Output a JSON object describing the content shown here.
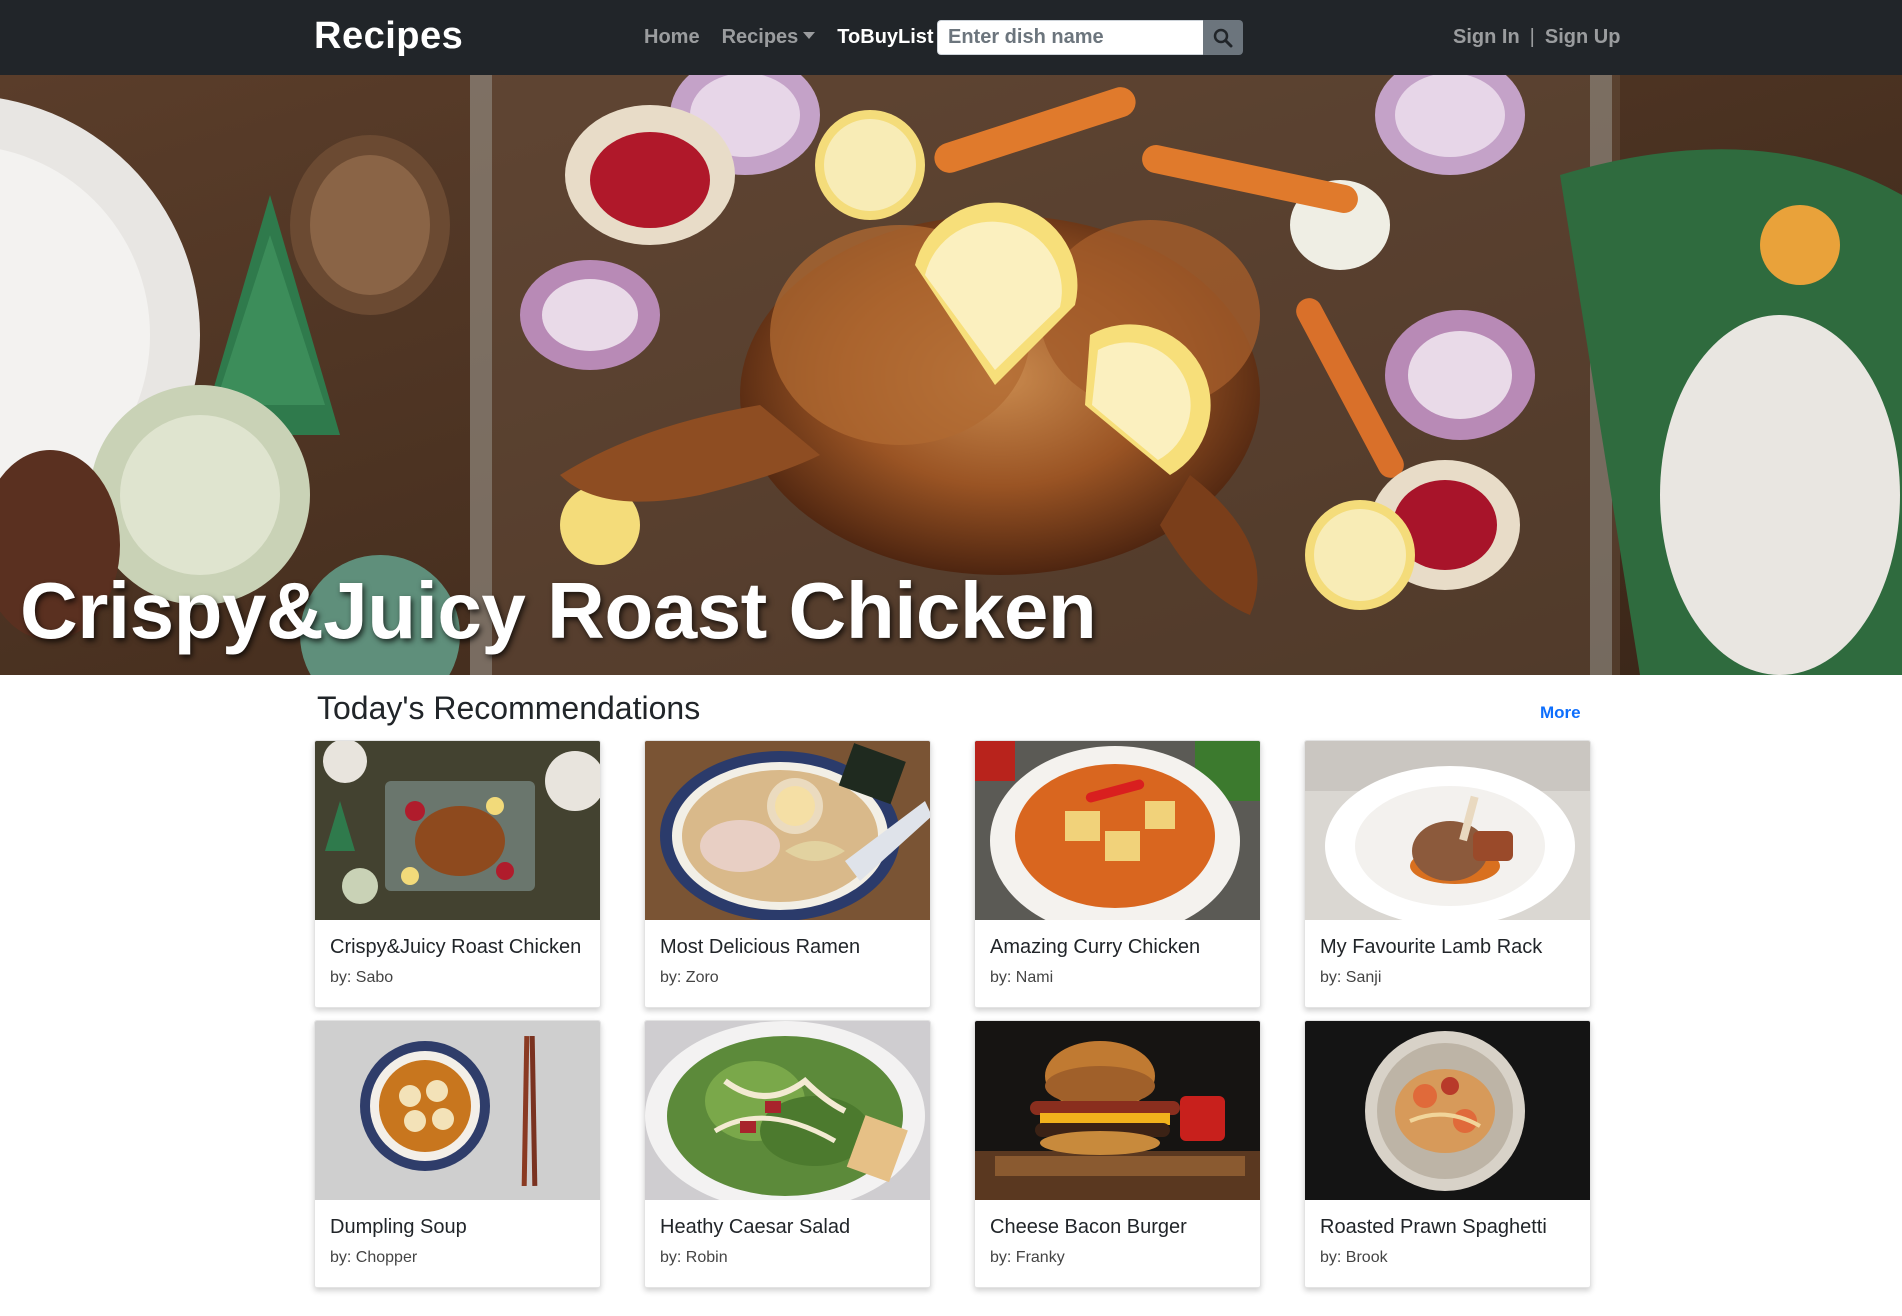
{
  "navbar": {
    "brand": "Recipes",
    "links": [
      {
        "label": "Home"
      },
      {
        "label": "Recipes"
      },
      {
        "label": "ToBuyList"
      }
    ],
    "search": {
      "placeholder": "Enter dish name",
      "value": ""
    },
    "auth": {
      "sign_in": "Sign In",
      "separator": "|",
      "sign_up": "Sign Up"
    }
  },
  "hero": {
    "title": "Crispy&Juicy Roast Chicken"
  },
  "recommendations": {
    "title": "Today's Recommendations",
    "more_label": "More",
    "cards": [
      {
        "title": "Crispy&Juicy Roast Chicken",
        "author": "by: Sabo"
      },
      {
        "title": "Most Delicious Ramen",
        "author": "by: Zoro"
      },
      {
        "title": "Amazing Curry Chicken",
        "author": "by: Nami"
      },
      {
        "title": "My Favourite Lamb Rack",
        "author": "by: Sanji"
      },
      {
        "title": "Dumpling Soup",
        "author": "by: Chopper"
      },
      {
        "title": "Heathy Caesar Salad",
        "author": "by: Robin"
      },
      {
        "title": "Cheese Bacon Burger",
        "author": "by: Franky"
      },
      {
        "title": "Roasted Prawn Spaghetti",
        "author": "by: Brook"
      }
    ]
  },
  "colors": {
    "navbar_bg": "#212529",
    "accent_link": "#0d6efd"
  }
}
